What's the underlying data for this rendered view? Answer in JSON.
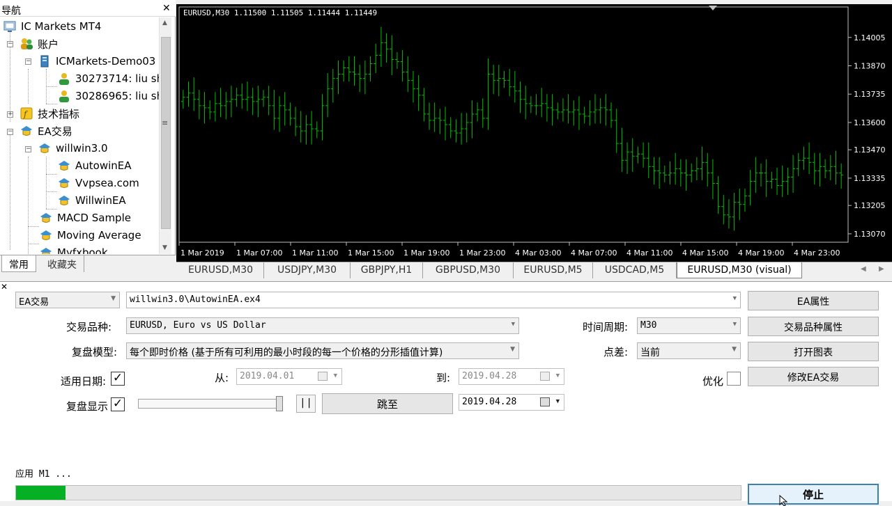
{
  "navigator": {
    "title": "导航",
    "tree": [
      {
        "label": "IC Markets MT4",
        "icon": "terminal-icon"
      },
      {
        "label": "账户",
        "icon": "accounts-icon"
      },
      {
        "label": "ICMarkets-Demo03",
        "icon": "server-icon"
      },
      {
        "label": "30273714: liu sh",
        "icon": "user-icon"
      },
      {
        "label": "30286965: liu sh",
        "icon": "user-icon"
      },
      {
        "label": "技术指标",
        "icon": "indicators-icon"
      },
      {
        "label": "EA交易",
        "icon": "expert-advisor-icon"
      },
      {
        "label": "willwin3.0",
        "icon": "expert-advisor-icon"
      },
      {
        "label": "AutowinEA",
        "icon": "expert-advisor-icon"
      },
      {
        "label": "Vvpsea.com",
        "icon": "expert-advisor-icon"
      },
      {
        "label": "WillwinEA",
        "icon": "expert-advisor-icon"
      },
      {
        "label": "MACD Sample",
        "icon": "expert-advisor-icon"
      },
      {
        "label": "Moving Average",
        "icon": "expert-advisor-icon"
      },
      {
        "label": "Myfxbook",
        "icon": "expert-advisor-icon"
      }
    ],
    "tabs": [
      "常用",
      "收藏夹"
    ]
  },
  "chart": {
    "info": "EURUSD,M30  1.11500 1.11505 1.11444 1.11449",
    "colors": {
      "background": "#000000",
      "bars": "#00c000",
      "grid": "#404040",
      "text": "#ffffff"
    }
  },
  "chart_data": {
    "type": "ohlc",
    "symbol": "EURUSD,M30",
    "ylim": [
      1.1303,
      1.1415
    ],
    "yticks": [
      "1.14005",
      "1.13870",
      "1.13735",
      "1.13600",
      "1.13470",
      "1.13335",
      "1.13205",
      "1.13070"
    ],
    "ytick_values": [
      1.14005,
      1.1387,
      1.13735,
      1.136,
      1.1347,
      1.13335,
      1.13205,
      1.1307
    ],
    "xticks": [
      "1 Mar 2019",
      "1 Mar 07:00",
      "1 Mar 11:00",
      "1 Mar 15:00",
      "1 Mar 19:00",
      "1 Mar 23:00",
      "4 Mar 03:00",
      "4 Mar 07:00",
      "4 Mar 11:00",
      "4 Mar 15:00",
      "4 Mar 19:00",
      "4 Mar 23:00"
    ],
    "closes": [
      1.1372,
      1.1374,
      1.1371,
      1.1368,
      1.1367,
      1.1365,
      1.1369,
      1.1368,
      1.137,
      1.1371,
      1.1373,
      1.1371,
      1.1372,
      1.137,
      1.1371,
      1.1372,
      1.1368,
      1.1362,
      1.1368,
      1.1366,
      1.1362,
      1.1358,
      1.1356,
      1.1359,
      1.1357,
      1.1356,
      1.1368,
      1.1376,
      1.1381,
      1.1383,
      1.1386,
      1.1384,
      1.1383,
      1.1381,
      1.1383,
      1.1388,
      1.1392,
      1.1398,
      1.1395,
      1.139,
      1.1389,
      1.1384,
      1.138,
      1.1376,
      1.1373,
      1.1364,
      1.1361,
      1.1362,
      1.1361,
      1.1359,
      1.1356,
      1.1355,
      1.1357,
      1.136,
      1.1364,
      1.1366,
      1.1362,
      1.1383,
      1.138,
      1.1381,
      1.138,
      1.1377,
      1.1375,
      1.1371,
      1.1369,
      1.1368,
      1.1368,
      1.1369,
      1.1367,
      1.1366,
      1.1365,
      1.1366,
      1.1365,
      1.1366,
      1.1364,
      1.1363,
      1.1365,
      1.1366,
      1.1367,
      1.1366,
      1.1361,
      1.135,
      1.1342,
      1.1346,
      1.1344,
      1.1345,
      1.1343,
      1.1339,
      1.1337,
      1.1336,
      1.1335,
      1.1336,
      1.1338,
      1.1336,
      1.1335,
      1.1337,
      1.1338,
      1.1341,
      1.1336,
      1.1331,
      1.132,
      1.1316,
      1.1315,
      1.1322,
      1.1321,
      1.1325,
      1.1332,
      1.1336,
      1.1336,
      1.1332,
      1.1333,
      1.133,
      1.1332,
      1.1334,
      1.1338,
      1.1342,
      1.1343,
      1.1341,
      1.1337,
      1.1339,
      1.1337,
      1.1339,
      1.1336,
      1.1335
    ]
  },
  "chart_tabs": [
    "EURUSD,M30",
    "USDJPY,M30",
    "GBPJPY,H1",
    "GBPUSD,M30",
    "EURUSD,M5",
    "USDCAD,M5",
    "EURUSD,M30 (visual)"
  ],
  "tester": {
    "type_combo": "EA交易",
    "ea_combo": "willwin3.0\\AutowinEA.ex4",
    "symbol_label": "交易品种:",
    "symbol_value": "EURUSD, Euro vs US Dollar",
    "model_label": "复盘模型:",
    "model_value": "每个即时价格 (基于所有可利用的最小时段的每一个价格的分形插值计算)",
    "date_label": "适用日期:",
    "from_label": "从:",
    "from_value": "2019.04.01",
    "to_label": "到:",
    "to_value": "2019.04.28",
    "visual_label": "复盘显示",
    "pause_label": "| |",
    "jump_label": "跳至",
    "jump_date": "2019.04.28",
    "period_label": "时间周期:",
    "period_value": "M30",
    "spread_label": "点差:",
    "spread_value": "当前",
    "optimize_label": "优化",
    "btn_ea_props": "EA属性",
    "btn_symbol_props": "交易品种属性",
    "btn_open_chart": "打开图表",
    "btn_modify_ea": "修改EA交易",
    "status": "应用 M1 ...",
    "progress": 0.068,
    "stop_label": "停止",
    "use_date_checked": true,
    "visual_checked": true,
    "optimize_checked": false
  }
}
